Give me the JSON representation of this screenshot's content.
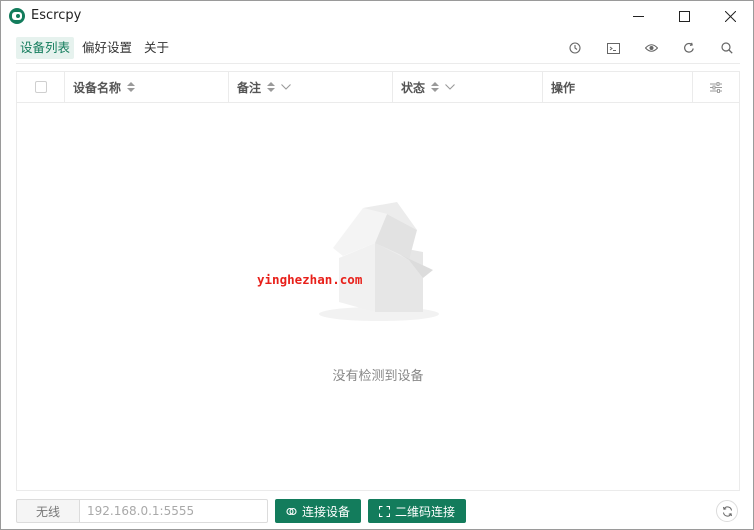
{
  "window": {
    "title": "Escrcpy",
    "controls": [
      "minimize-icon",
      "maximize-icon",
      "close-icon"
    ]
  },
  "nav": {
    "items": [
      {
        "label": "设备列表",
        "active": true
      },
      {
        "label": "偏好设置",
        "active": false
      },
      {
        "label": "关于",
        "active": false
      }
    ]
  },
  "toolbar": {
    "icons": [
      "history-icon",
      "terminal-icon",
      "eye-icon",
      "refresh-icon",
      "search-icon"
    ]
  },
  "table": {
    "columns": [
      {
        "label": "设备名称",
        "sortable": true,
        "filterable": false
      },
      {
        "label": "备注",
        "sortable": true,
        "filterable": true
      },
      {
        "label": "状态",
        "sortable": true,
        "filterable": true
      },
      {
        "label": "操作",
        "sortable": false,
        "filterable": false
      }
    ],
    "rows": [],
    "empty_text": "没有检测到设备"
  },
  "watermark": "yinghezhan.com",
  "footer": {
    "mode_label": "无线",
    "ip_placeholder": "192.168.0.1:5555",
    "connect_label": "连接设备",
    "qr_label": "二维码连接"
  },
  "colors": {
    "accent": "#137c5c",
    "accent_light": "#e6f2ee",
    "border": "#ebebeb",
    "watermark": "#e8201a"
  }
}
